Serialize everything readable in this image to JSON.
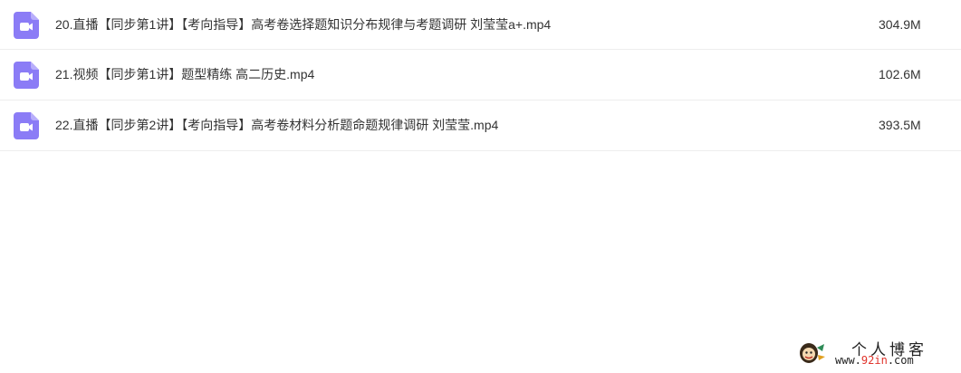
{
  "colors": {
    "icon_bg": "#8b7cf6",
    "icon_fold": "#b8aefb",
    "text": "#333333",
    "divider": "#ededed"
  },
  "files": [
    {
      "icon": "video-file-icon",
      "name": "20.直播【同步第1讲】【考向指导】高考卷选择题知识分布规律与考题调研 刘莹莹a+.mp4",
      "size": "304.9M"
    },
    {
      "icon": "video-file-icon",
      "name": "21.视频【同步第1讲】题型精练 高二历史.mp4",
      "size": "102.6M"
    },
    {
      "icon": "video-file-icon",
      "name": "22.直播【同步第2讲】【考向指导】高考卷材料分析题命题规律调研 刘莹莹.mp4",
      "size": "393.5M"
    }
  ],
  "watermark": {
    "title": "个人博客",
    "url_prefix": "www.",
    "url_accent": "92in",
    "url_suffix": ".com"
  }
}
